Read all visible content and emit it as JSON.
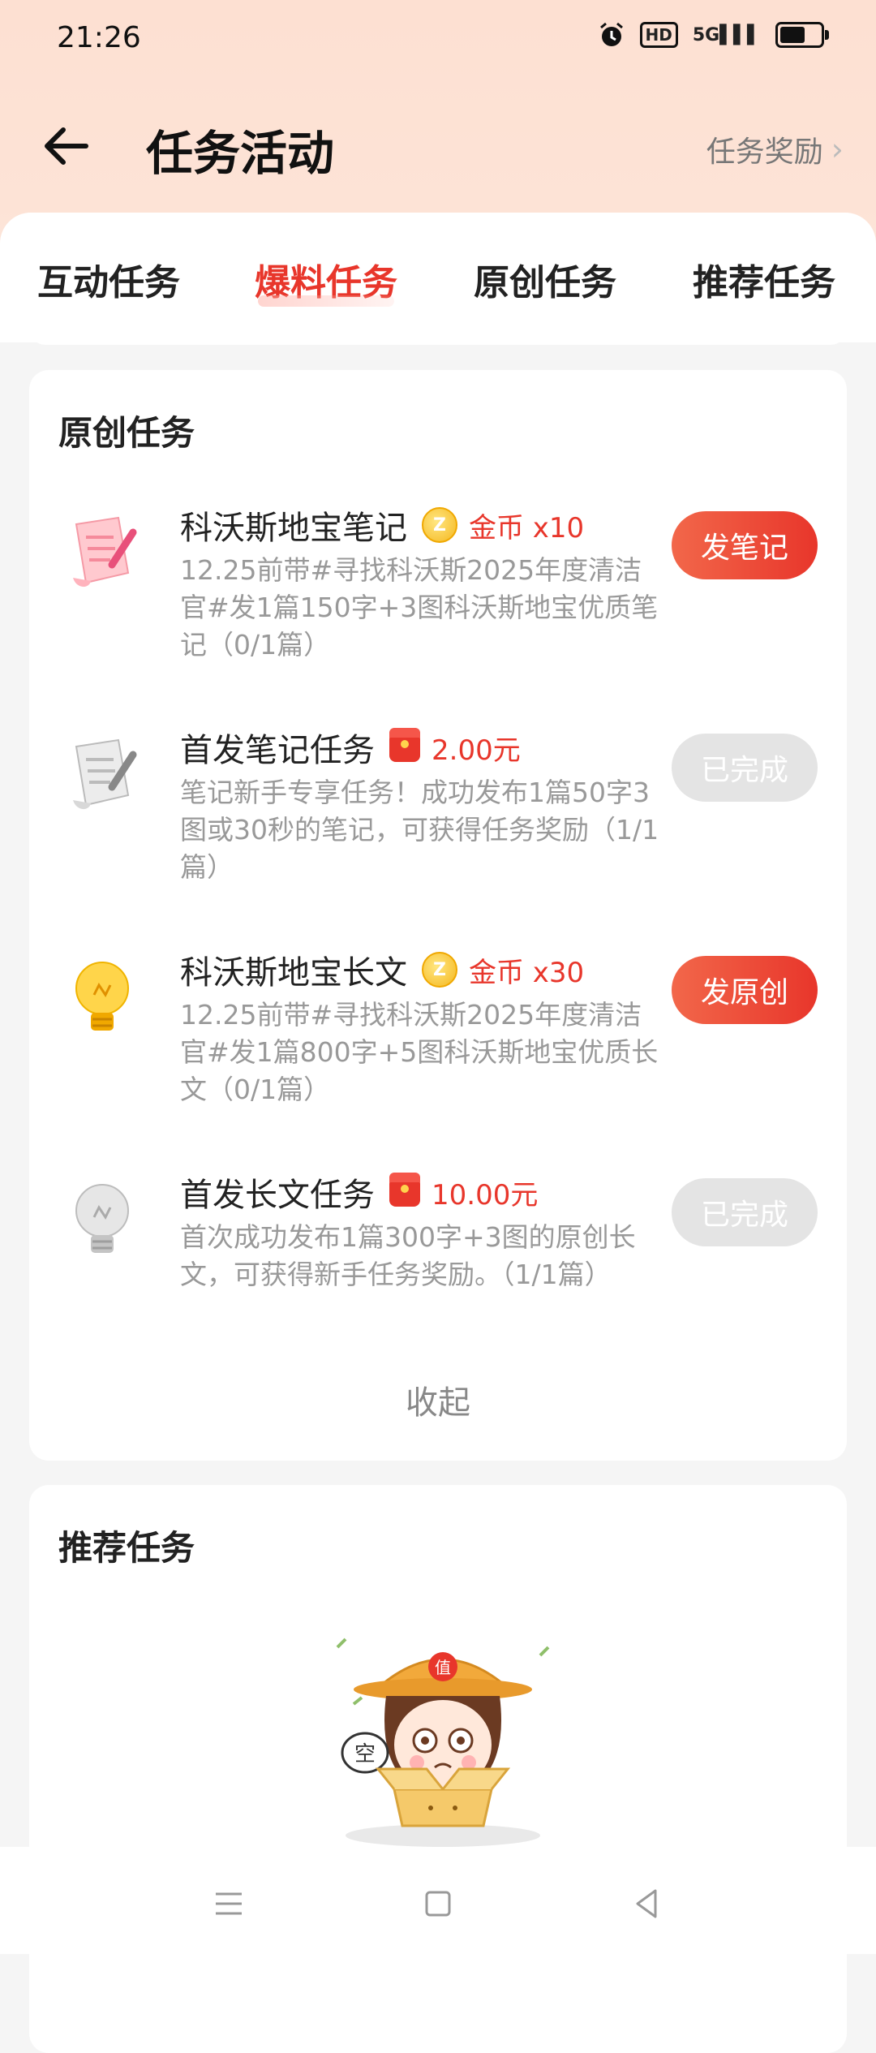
{
  "status_bar": {
    "time": "21:26",
    "hd": "HD",
    "network": "5G"
  },
  "header": {
    "title": "任务活动",
    "reward_link": "任务奖励"
  },
  "tabs": [
    {
      "label": "互动任务",
      "active": false
    },
    {
      "label": "爆料任务",
      "active": true
    },
    {
      "label": "原创任务",
      "active": false
    },
    {
      "label": "推荐任务",
      "active": false
    }
  ],
  "original_section": {
    "title": "原创任务",
    "tasks": [
      {
        "icon": "note-pink-icon",
        "name": "科沃斯地宝笔记",
        "reward_type": "coin",
        "reward_label": "金币 x10",
        "desc": "12.25前带#寻找科沃斯2025年度清洁官#发1篇150字+3图科沃斯地宝优质笔记（0/1篇）",
        "button": "发笔记",
        "done": false
      },
      {
        "icon": "note-gray-icon",
        "name": "首发笔记任务",
        "reward_type": "redpacket",
        "reward_label": "2.00元",
        "desc": "笔记新手专享任务！成功发布1篇50字3图或30秒的笔记，可获得任务奖励（1/1篇）",
        "button": "已完成",
        "done": true
      },
      {
        "icon": "bulb-yellow-icon",
        "name": "科沃斯地宝长文",
        "reward_type": "coin",
        "reward_label": "金币 x30",
        "desc": "12.25前带#寻找科沃斯2025年度清洁官#发1篇800字+5图科沃斯地宝优质长文（0/1篇）",
        "button": "发原创",
        "done": false
      },
      {
        "icon": "bulb-gray-icon",
        "name": "首发长文任务",
        "reward_type": "redpacket",
        "reward_label": "10.00元",
        "desc": "首次成功发布1篇300字+3图的原创长文，可获得新手任务奖励。（1/1篇）",
        "button": "已完成",
        "done": true
      }
    ],
    "collapse_label": "收起"
  },
  "recommend_section": {
    "title": "推荐任务",
    "empty_illustration": "empty-box-mascot",
    "empty_text": "空",
    "badge_text": "值"
  },
  "colors": {
    "accent": "#e8362b",
    "header_bg": "#fde0d2",
    "done_btn": "#e4e4e4"
  }
}
